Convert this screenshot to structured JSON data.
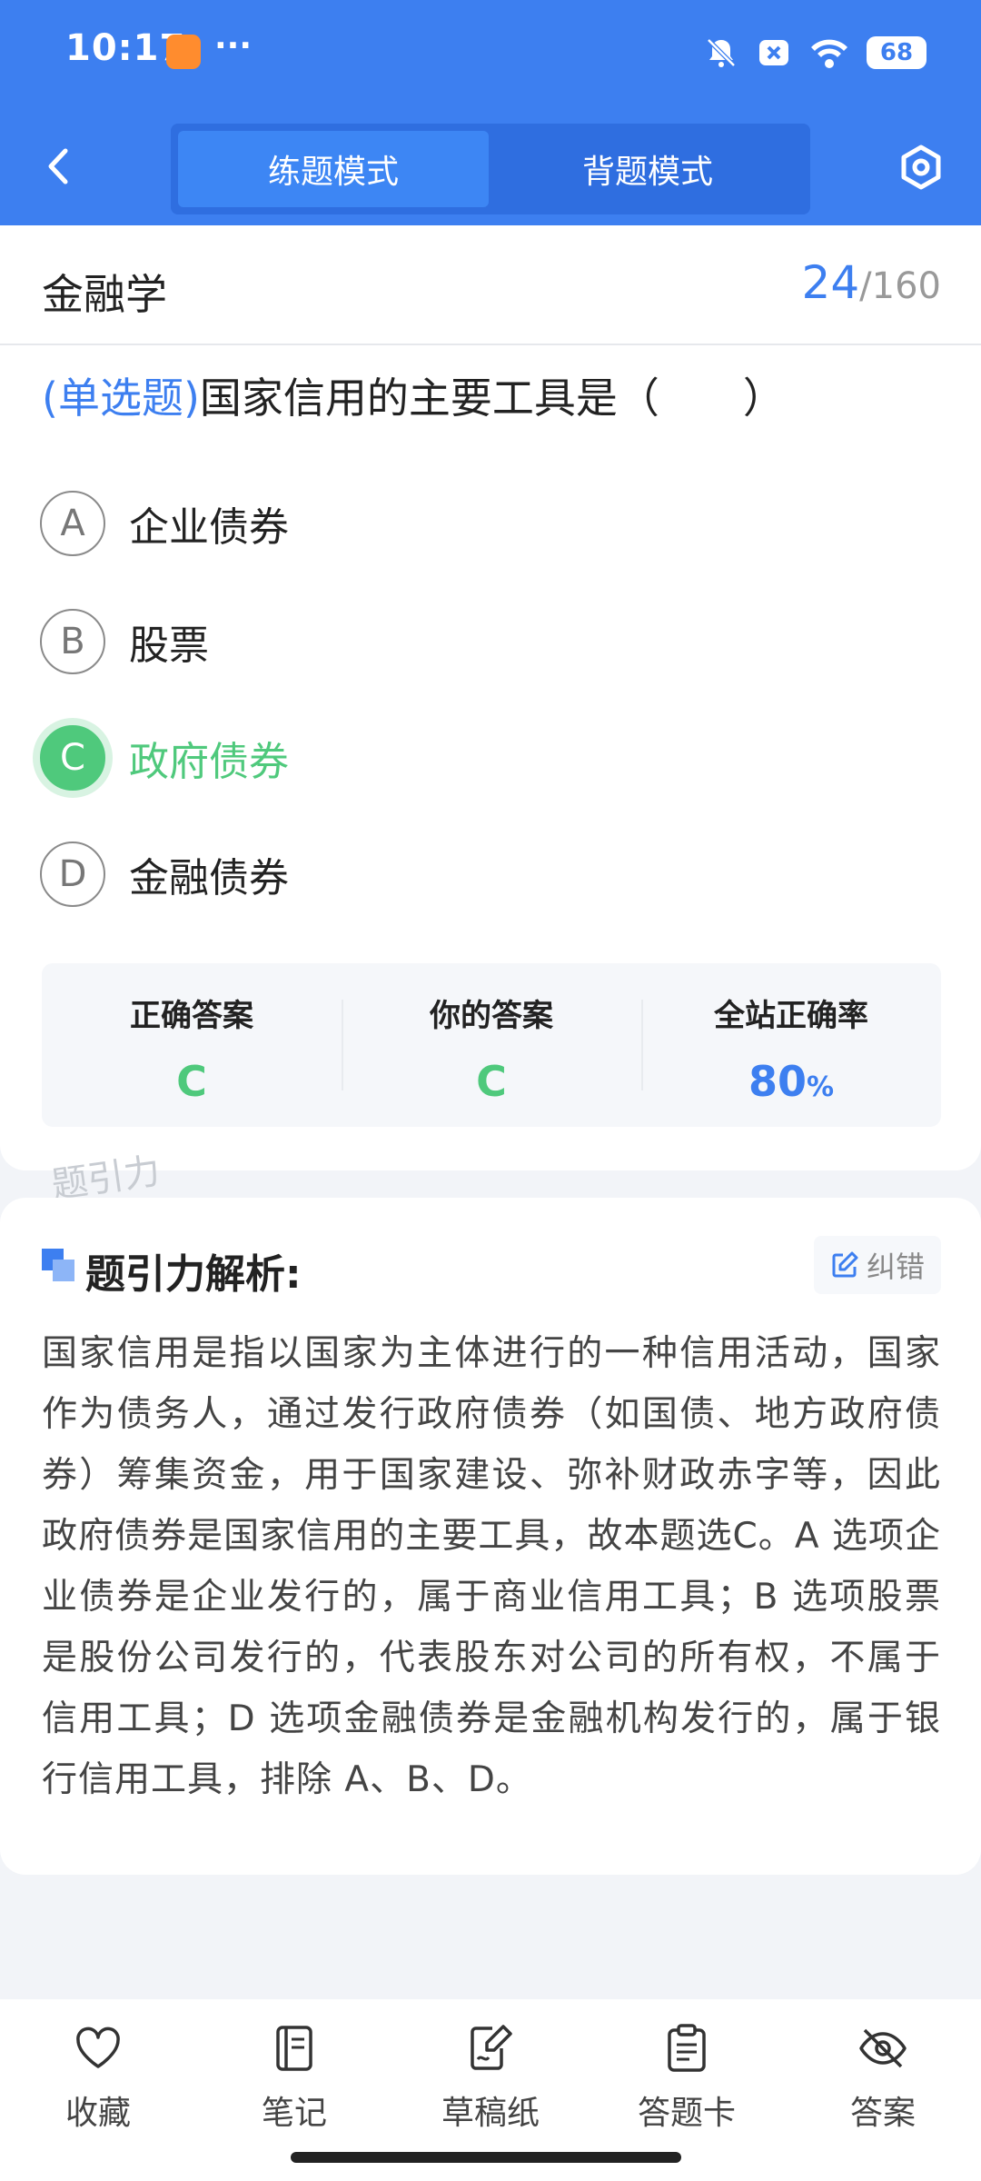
{
  "status_bar": {
    "time": "10:17",
    "dots": "···",
    "battery": "68"
  },
  "nav": {
    "mode_practice": "练题模式",
    "mode_memorize": "背题模式"
  },
  "question_card": {
    "subject": "金融学",
    "current": "24",
    "separator": "/",
    "total": "160",
    "question_type": "(单选题)",
    "question_text": "国家信用的主要工具是（　　）",
    "options": [
      {
        "letter": "A",
        "text": "企业债券"
      },
      {
        "letter": "B",
        "text": "股票"
      },
      {
        "letter": "C",
        "text": "政府债券"
      },
      {
        "letter": "D",
        "text": "金融债券"
      }
    ],
    "result": {
      "correct_label": "正确答案",
      "correct_value": "C",
      "yours_label": "你的答案",
      "yours_value": "C",
      "rate_label": "全站正确率",
      "rate_value": "80",
      "rate_unit": "%"
    },
    "watermark": "题引力"
  },
  "analysis": {
    "title": "题引力解析:",
    "report_label": "纠错",
    "body": "国家信用是指以国家为主体进行的一种信用活动，国家作为债务人，通过发行政府债券（如国债、地方政府债券）筹集资金，用于国家建设、弥补财政赤字等，因此政府债券是国家信用的主要工具，故本题选C。A 选项企业债券是企业发行的，属于商业信用工具；B 选项股票是股份公司发行的，代表股东对公司的所有权，不属于信用工具；D 选项金融债券是金融机构发行的，属于银行信用工具，排除 A、B、D。"
  },
  "bottom_bar": {
    "favorite": "收藏",
    "notes": "笔记",
    "scratch": "草稿纸",
    "answer_card": "答题卡",
    "answer": "答案"
  },
  "colors": {
    "primary": "#3d7ff0",
    "correct": "#4fc97c"
  }
}
